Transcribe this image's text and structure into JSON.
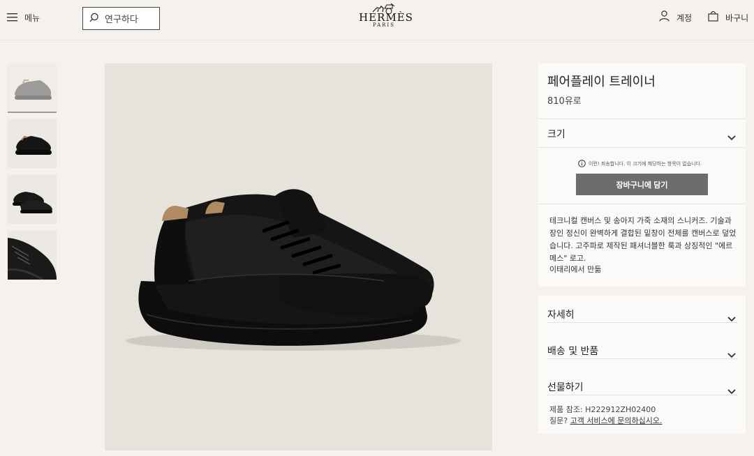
{
  "header": {
    "menu_label": "메뉴",
    "search_placeholder": "연구하다",
    "brand": "HERMÈS",
    "brand_city": "PARIS",
    "account_label": "계정",
    "cart_label": "바구니"
  },
  "product": {
    "title": "페어플레이 트레이너",
    "price": "810유로",
    "size_label": "크기",
    "size_notice": "이런! 죄송합니다. 이 크기에 해당하는 항목이 없습니다.",
    "add_to_cart": "장바구니에 담기",
    "description": "테크니컬 캔버스 및 송아지 가죽 소재의 스니커즈. 기술과 장인 정신이 완벽하게 결합된 밑창이 전체를 캔버스로 덮었습니다. 고주파로 제작된 패셔너블한 룩과 상징적인 \"에르메스\" 로고.",
    "made_in": "이태리에서 만듦"
  },
  "accordion": {
    "details": "자세히",
    "shipping": "배송 및 반품",
    "gift": "선물하기"
  },
  "footer_info": {
    "reference": "제품 참조: H222912ZH02400",
    "question_prefix": "질문? ",
    "question_link": "고객 서비스에 문의하십시오."
  },
  "thumbnails": [
    "side-view",
    "front-three-quarter",
    "pair-view",
    "top-detail"
  ],
  "colors": {
    "background": "#f5f2ee",
    "panel": "#fbfaf8",
    "button": "#6d6d6d",
    "image_bg": "#e6e2dc"
  }
}
